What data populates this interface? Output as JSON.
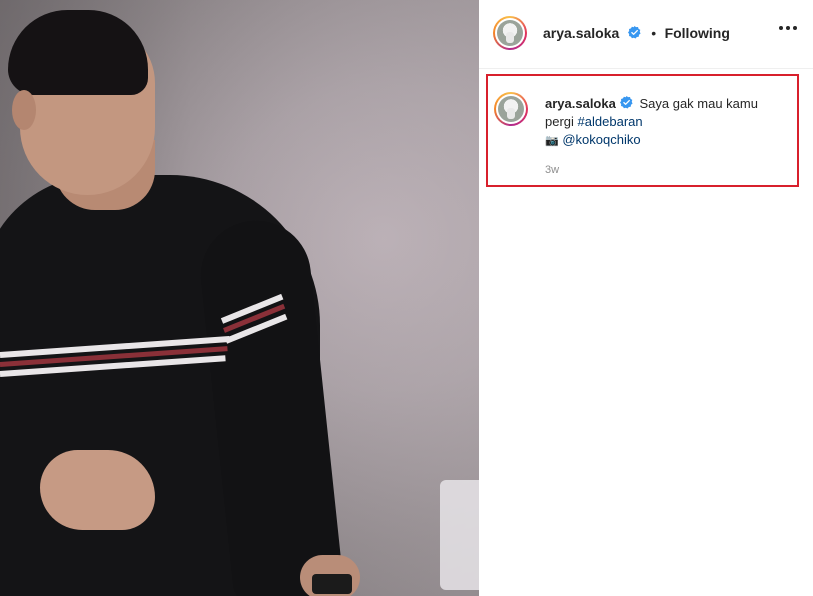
{
  "post": {
    "username": "arya.saloka",
    "separator": "•",
    "follow_status": "Following",
    "caption_text": "Saya gak mau kamu pergi",
    "hashtag": "#aldebaran",
    "camera_emoji": "📷",
    "mention": "@kokoqchiko",
    "timestamp": "3w"
  },
  "colors": {
    "verified_badge": "#3897f0",
    "highlight_border": "#d8202c",
    "link": "#00376b",
    "muted": "#8e8e8e"
  },
  "icons": {
    "verified": "verified-badge-icon",
    "more": "more-options-icon",
    "camera": "camera-emoji-icon"
  }
}
